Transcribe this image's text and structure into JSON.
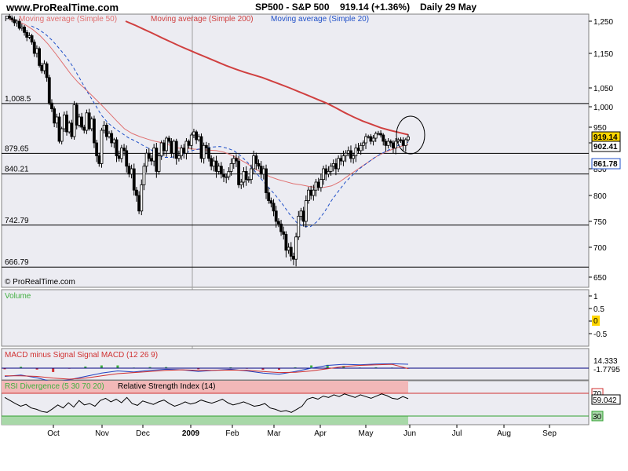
{
  "header": {
    "site": "www.ProRealTime.com",
    "symbol": "SP500 - S&P 500",
    "last_quote": "919.14 (+1.36%)",
    "period": "Daily  29 May"
  },
  "watermark": "© ProRealTime.com",
  "colors": {
    "grid_line": "#9aa0b8",
    "price_up": "#ffffff",
    "price_down": "#000000",
    "ma50": "#e07070",
    "ma200": "#d04040",
    "ma20": "#2050c8",
    "macd_line": "#2040c0",
    "signal_line": "#d03030",
    "histogram": "#40b040",
    "rsi_band_high": "#f2b8b8",
    "rsi_band_low": "#a8d8a8"
  },
  "chart_data": [
    {
      "type": "candlestick",
      "title": "SP500 - S&P 500",
      "legend": [
        "P",
        "Moving average (Simple 50)",
        "Moving average (Simple 200)",
        "Moving average (Simple 20)"
      ],
      "ylim": [
        615,
        1265
      ],
      "y_ticks": [
        650,
        700,
        750,
        800,
        850,
        900,
        950,
        "1,000",
        "1,050",
        "1,150",
        "1,250"
      ],
      "x_ticks": [
        "Oct",
        "Nov",
        "Dec",
        "2009",
        "Feb",
        "Mar",
        "Apr",
        "May",
        "Jun",
        "Jul",
        "Aug",
        "Sep"
      ],
      "horizontal_levels": [
        {
          "label": "1,008.5",
          "value": 1008.5
        },
        {
          "label": "879.65",
          "value": 879.65
        },
        {
          "label": "840.21",
          "value": 840.21
        },
        {
          "label": "742.79",
          "value": 742.79
        },
        {
          "label": "666.79",
          "value": 666.79
        }
      ],
      "right_labels": [
        {
          "text": "919.14",
          "value": 919.14
        },
        {
          "text": "902.41",
          "value": 902.41
        },
        {
          "text": "861.78",
          "value": 861.78
        }
      ],
      "closes": [
        1260,
        1255,
        1245,
        1250,
        1228,
        1232,
        1215,
        1200,
        1205,
        1185,
        1150,
        1165,
        1115,
        1100,
        1120,
        1080,
        1010,
        995,
        960,
        975,
        905,
        945,
        980,
        935,
        960,
        920,
        1005,
        955,
        975,
        950,
        940,
        985,
        945,
        970,
        900,
        875,
        860,
        940,
        955,
        920,
        930,
        900,
        910,
        875,
        870,
        890,
        885,
        855,
        840,
        850,
        810,
        800,
        770,
        820,
        855,
        880,
        870,
        865,
        890,
        845,
        875,
        900,
        885,
        915,
        905,
        880,
        905,
        870,
        875,
        890,
        880,
        905,
        895,
        925,
        935,
        910,
        920,
        870,
        895,
        890,
        870,
        855,
        865,
        845,
        855,
        840,
        835,
        835,
        845,
        860,
        870,
        865,
        820,
        825,
        845,
        830,
        830,
        850,
        875,
        860,
        855,
        840,
        850,
        805,
        790,
        785,
        770,
        750,
        745,
        730,
        725,
        695,
        700,
        685,
        680,
        720,
        760,
        770,
        750,
        790,
        810,
        800,
        810,
        825,
        815,
        830,
        850,
        840,
        845,
        855,
        860,
        850,
        870,
        865,
        875,
        880,
        885,
        870,
        875,
        890,
        885,
        895,
        900,
        920,
        920,
        905,
        915,
        930,
        930,
        925,
        905,
        895,
        905,
        900,
        890,
        905,
        910,
        908,
        895,
        910,
        919.14
      ],
      "series": [
        {
          "name": "Moving average (Simple 200)",
          "y": [
            1250,
            1238,
            1225,
            1212,
            1198,
            1185,
            1172,
            1160,
            1148,
            1137,
            1126,
            1115,
            1105,
            1096,
            1088,
            1080,
            1070,
            1060,
            1050,
            1040,
            1030,
            1020,
            1010,
            998,
            986,
            975,
            965,
            957,
            948,
            940,
            933,
            926
          ]
        },
        {
          "name": "Moving average (Simple 50)",
          "y": [
            1255,
            1250,
            1240,
            1225,
            1205,
            1180,
            1150,
            1120,
            1090,
            1065,
            1045,
            1025,
            1005,
            985,
            965,
            945,
            930,
            920,
            912,
            905,
            900,
            895,
            890,
            890,
            888,
            887,
            886,
            885,
            882,
            876,
            868,
            860,
            850,
            842,
            835,
            830,
            826,
            822,
            820,
            817,
            815,
            815,
            818,
            825,
            835,
            845,
            855,
            865,
            875,
            882,
            888,
            893,
            897
          ]
        },
        {
          "name": "Moving average (Simple 20)",
          "y": [
            1235,
            1225,
            1210,
            1190,
            1165,
            1140,
            1110,
            1075,
            1040,
            1010,
            980,
            960,
            945,
            930,
            915,
            905,
            895,
            888,
            878,
            872,
            872,
            875,
            880,
            885,
            888,
            890,
            892,
            893,
            890,
            885,
            875,
            862,
            846,
            830,
            815,
            800,
            783,
            764,
            748,
            740,
            740,
            750,
            768,
            790,
            808,
            825,
            838,
            850,
            860,
            870,
            878,
            885,
            892,
            897,
            902
          ]
        }
      ]
    },
    {
      "type": "bar",
      "title": "Volume",
      "y_ticks": [
        "1",
        "0.5",
        "0",
        "-0.5"
      ],
      "right_labels": [
        {
          "text": "0",
          "value": 0
        }
      ],
      "values": []
    },
    {
      "type": "line",
      "title": "MACD minus Signal Signal MACD (12 26 9)",
      "right_labels": [
        {
          "text": "14.333",
          "value": 14.333
        },
        {
          "text": "-1.7795",
          "value": -1.7795
        }
      ],
      "series": [
        {
          "name": "MACD",
          "y": [
            -30,
            -25,
            -35,
            -50,
            -42,
            -30,
            -18,
            -10,
            -14,
            -8,
            -4,
            -6,
            -12,
            -8,
            -4,
            -10,
            -18,
            -22,
            -12,
            0,
            10,
            14,
            12,
            15,
            16,
            14.333
          ]
        },
        {
          "name": "Signal",
          "y": [
            -28,
            -28,
            -30,
            -36,
            -40,
            -36,
            -28,
            -20,
            -16,
            -12,
            -8,
            -6,
            -8,
            -8,
            -7,
            -8,
            -12,
            -16,
            -15,
            -10,
            -2,
            6,
            10,
            12,
            14,
            -1.7795
          ]
        }
      ],
      "histogram": [
        -4,
        5,
        -5,
        -14,
        -2,
        6,
        10,
        10,
        2,
        4,
        4,
        0,
        -4,
        0,
        3,
        -2,
        -6,
        -6,
        3,
        10,
        12,
        8,
        2,
        3,
        2,
        -2
      ]
    },
    {
      "type": "line",
      "title": "Relative Strength Index (14)",
      "subtitle": "RSI Divergence (5 30 70 20)",
      "levels": [
        {
          "label": "70",
          "value": 70
        },
        {
          "label": "30",
          "value": 30
        }
      ],
      "right_labels": [
        {
          "text": "59.042",
          "value": 59.042
        }
      ],
      "ylim": [
        0,
        100
      ],
      "series": [
        {
          "name": "RSI",
          "y": [
            62,
            55,
            48,
            42,
            46,
            38,
            35,
            30,
            28,
            36,
            45,
            38,
            50,
            40,
            55,
            45,
            48,
            42,
            55,
            60,
            52,
            58,
            50,
            62,
            48,
            44,
            54,
            50,
            46,
            52,
            56,
            48,
            42,
            46,
            52,
            47,
            50,
            56,
            52,
            49,
            53,
            58,
            50,
            45,
            48,
            52,
            47,
            42,
            44,
            48,
            38,
            35,
            30,
            32,
            28,
            35,
            42,
            58,
            62,
            58,
            65,
            62,
            68,
            64,
            70,
            66,
            62,
            68,
            64,
            60,
            65,
            70,
            66,
            60,
            58,
            64,
            59.042
          ]
        }
      ]
    }
  ]
}
